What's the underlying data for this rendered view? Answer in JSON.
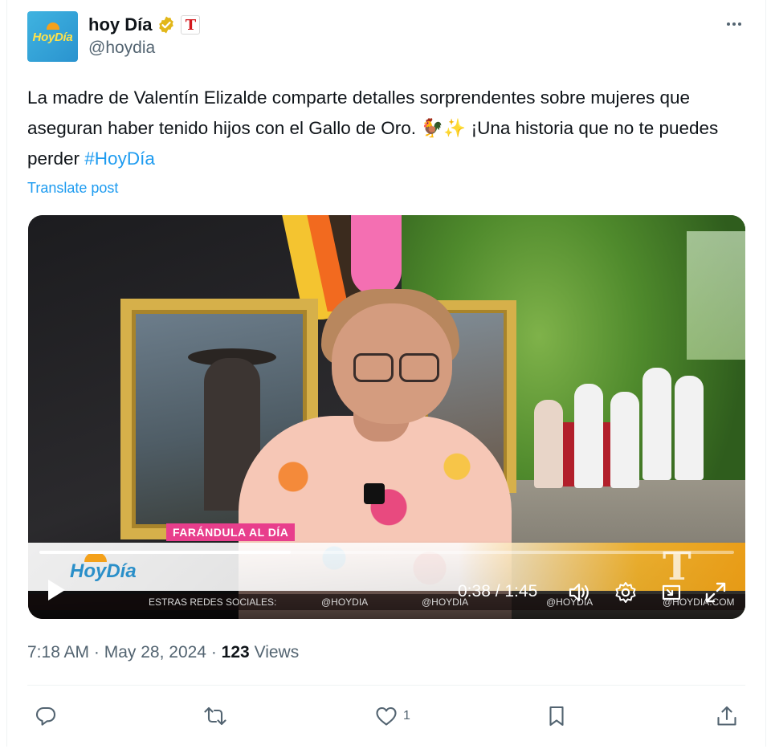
{
  "author": {
    "avatar_text": "HoyDía",
    "display_name": "hoy Día",
    "handle": "@hoydia",
    "affiliate_badge": "T",
    "verified": true
  },
  "tweet": {
    "text_main": "La madre de Valentín Elizalde comparte detalles sorprendentes sobre mujeres que aseguran haber tenido hijos con el Gallo de Oro. ",
    "emojis": "🐓✨",
    "text_tail": " ¡Una historia que no te puedes perder ",
    "hashtag": "#HoyDía",
    "translate_label": "Translate post"
  },
  "video": {
    "lower_third": "FARÁNDULA AL DÍA",
    "logo_text": "HoyDía",
    "channel_logo": "T",
    "current_time": "0:38",
    "duration": "1:45",
    "time_display": "0:38 / 1:45",
    "progress": 0.362,
    "social_strip": [
      "ESTRAS REDES SOCIALES:",
      "@HOYDIA",
      "@HOYDIA",
      "@HOYDIA",
      "@HOYDIA.COM"
    ]
  },
  "meta": {
    "time": "7:18 AM",
    "date": "May 28, 2024",
    "views_count": "123",
    "views_label": "Views"
  },
  "actions": {
    "reply_count": "",
    "repost_count": "",
    "like_count": "1",
    "bookmark_count": ""
  },
  "colors": {
    "link": "#1d9bf0",
    "text": "#0f1419",
    "muted": "#536471",
    "verified_gold": "#e2b719",
    "affiliate_red": "#d3161b",
    "lower_third_pink": "#e83e8c"
  }
}
